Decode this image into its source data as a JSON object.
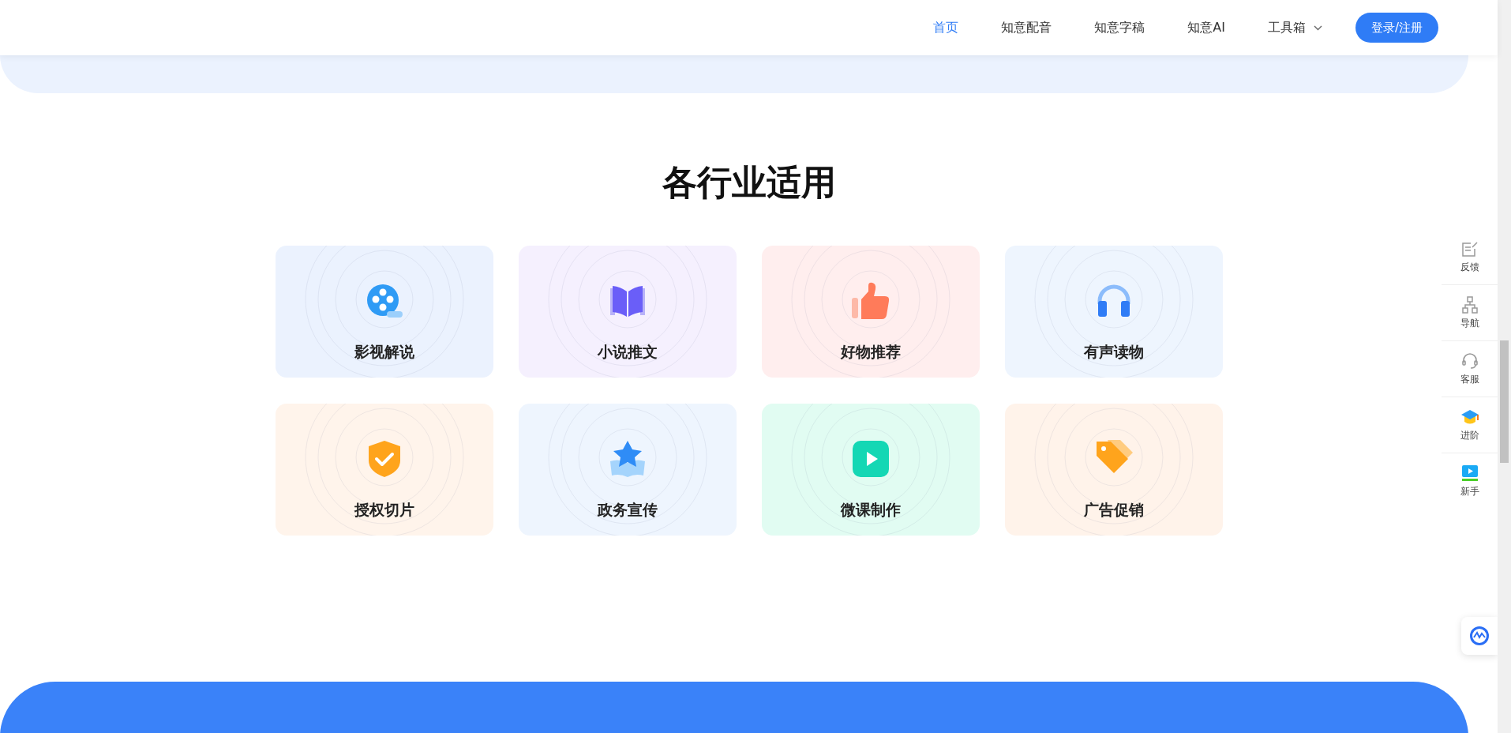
{
  "header": {
    "nav": [
      {
        "label": "首页",
        "selected": true,
        "dropdown": false
      },
      {
        "label": "知意配音",
        "selected": false,
        "dropdown": false
      },
      {
        "label": "知意字稿",
        "selected": false,
        "dropdown": false
      },
      {
        "label": "知意AI",
        "selected": false,
        "dropdown": false
      },
      {
        "label": "工具箱",
        "selected": false,
        "dropdown": true
      }
    ],
    "login_button": "登录/注册"
  },
  "section": {
    "title": "各行业适用",
    "cards": [
      {
        "label": "影视解说",
        "color": "#ebf2fe"
      },
      {
        "label": "小说推文",
        "color": "#f5f0fe"
      },
      {
        "label": "好物推荐",
        "color": "#ffeeee"
      },
      {
        "label": "有声读物",
        "color": "#eef5fe"
      },
      {
        "label": "授权切片",
        "color": "#fff4eb"
      },
      {
        "label": "政务宣传",
        "color": "#eef5fe"
      },
      {
        "label": "微课制作",
        "color": "#e1fcf2"
      },
      {
        "label": "广告促销",
        "color": "#fff3ea"
      }
    ]
  },
  "side_toolbar": {
    "items": [
      {
        "label": "反馈"
      },
      {
        "label": "导航"
      },
      {
        "label": "客服"
      },
      {
        "label": "进阶"
      },
      {
        "label": "新手"
      }
    ]
  }
}
